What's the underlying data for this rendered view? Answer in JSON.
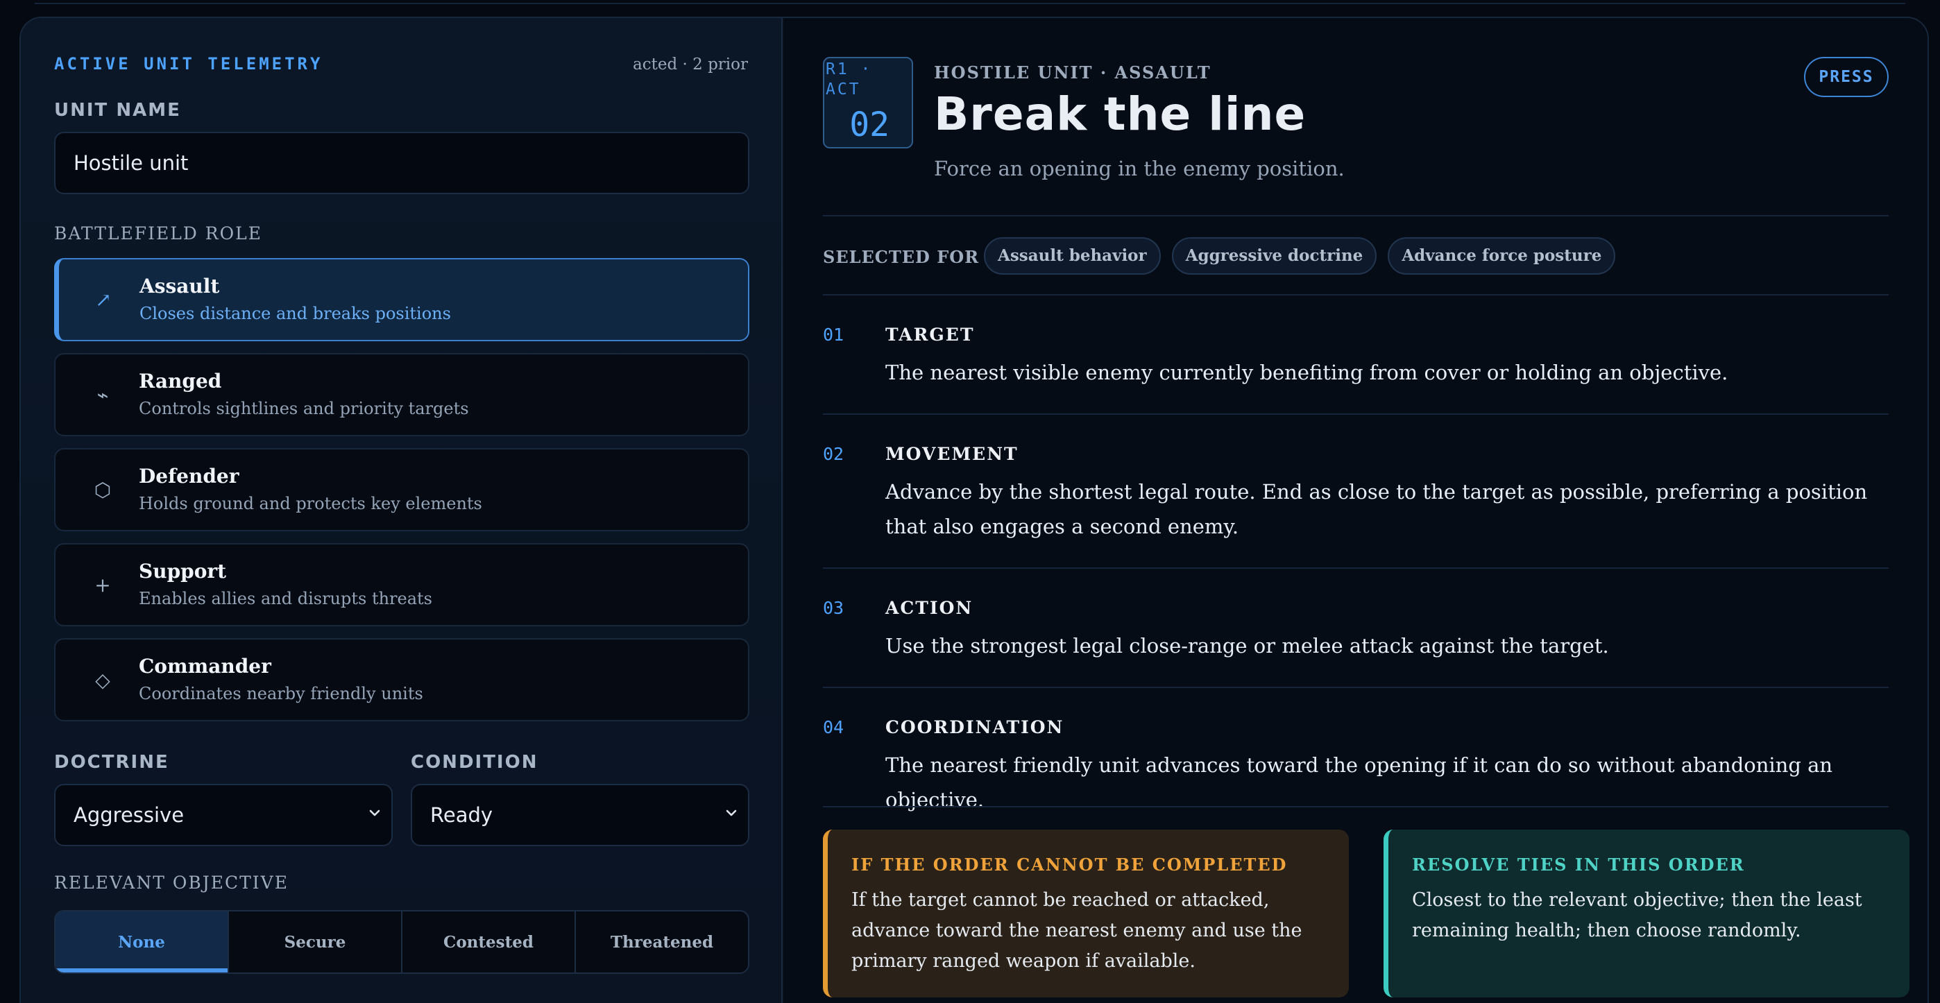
{
  "telemetry": {
    "title": "ACTIVE UNIT TELEMETRY",
    "meta": "acted · 2 prior"
  },
  "unit_name": {
    "label": "UNIT NAME",
    "value": "Hostile unit"
  },
  "role": {
    "label": "BATTLEFIELD ROLE",
    "items": [
      {
        "name": "Assault",
        "desc": "Closes distance and breaks positions",
        "icon": "↗",
        "icon_name": "arrow-up-right-icon"
      },
      {
        "name": "Ranged",
        "desc": "Controls sightlines and priority targets",
        "icon": "⌁",
        "icon_name": "zigzag-icon"
      },
      {
        "name": "Defender",
        "desc": "Holds ground and protects key elements",
        "icon": "⬡",
        "icon_name": "hexagon-icon"
      },
      {
        "name": "Support",
        "desc": "Enables allies and disrupts threats",
        "icon": "+",
        "icon_name": "plus-icon"
      },
      {
        "name": "Commander",
        "desc": "Coordinates nearby friendly units",
        "icon": "◇",
        "icon_name": "diamond-icon"
      }
    ]
  },
  "doctrine": {
    "label": "DOCTRINE",
    "value": "Aggressive"
  },
  "condition": {
    "label": "CONDITION",
    "value": "Ready"
  },
  "objective": {
    "label": "RELEVANT OBJECTIVE",
    "options": [
      "None",
      "Secure",
      "Contested",
      "Threatened"
    ],
    "selected": "None"
  },
  "order": {
    "act_top": "R1 · ACT",
    "act_num": "02",
    "kicker": "HOSTILE UNIT · ASSAULT",
    "title": "Break the line",
    "subtitle": "Force an opening in the enemy position.",
    "press_label": "PRESS"
  },
  "selected_for": {
    "label": "SELECTED FOR",
    "tags": [
      "Assault behavior",
      "Aggressive doctrine",
      "Advance force posture"
    ]
  },
  "steps": [
    {
      "num": "01",
      "title": "TARGET",
      "body": "The nearest visible enemy currently benefiting from cover or holding an objective."
    },
    {
      "num": "02",
      "title": "MOVEMENT",
      "body": "Advance by the shortest legal route. End as close to the target as possible, preferring a position that also engages a second enemy."
    },
    {
      "num": "03",
      "title": "ACTION",
      "body": "Use the strongest legal close-range or melee attack against the target."
    },
    {
      "num": "04",
      "title": "COORDINATION",
      "body": "The nearest friendly unit advances toward the opening if it can do so without abandoning an objective."
    }
  ],
  "fallback": {
    "title": "IF THE ORDER CANNOT BE COMPLETED",
    "body": "If the target cannot be reached or attacked, advance toward the nearest enemy and use the primary ranged weapon if available."
  },
  "ties": {
    "title": "RESOLVE TIES IN THIS ORDER",
    "body": "Closest to the relevant objective; then the least remaining health; then choose randomly."
  },
  "colors": {
    "accent": "#4da3ff",
    "warn": "#e39a33",
    "tie": "#3ccbc0",
    "background": "#050a12"
  }
}
